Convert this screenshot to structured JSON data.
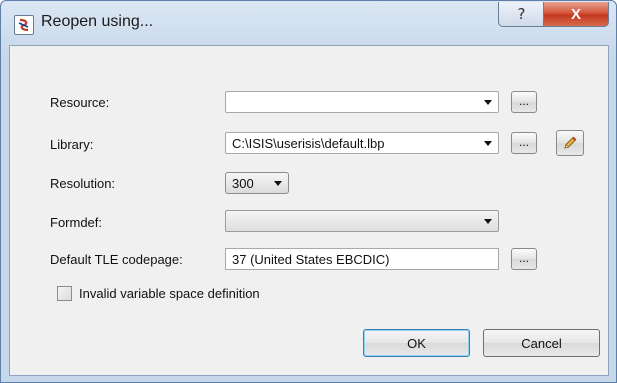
{
  "window": {
    "title": "Reopen using..."
  },
  "titlebar_buttons": {
    "help": "?",
    "close": "X"
  },
  "form": {
    "resource": {
      "label": "Resource:",
      "value": "",
      "browse": "..."
    },
    "library": {
      "label": "Library:",
      "value": "C:\\ISIS\\userisis\\default.lbp",
      "browse": "...",
      "edit_icon": "pencil-icon"
    },
    "resolution": {
      "label": "Resolution:",
      "value": "300"
    },
    "formdef": {
      "label": "Formdef:",
      "value": ""
    },
    "codepage": {
      "label": "Default TLE codepage:",
      "value": "37 (United States EBCDIC)",
      "browse": "..."
    },
    "invalid_space": {
      "label": "Invalid variable space definition",
      "checked": false
    }
  },
  "buttons": {
    "ok": "OK",
    "cancel": "Cancel"
  },
  "colors": {
    "accent": "#3c7fb1",
    "close": "#c2391f"
  }
}
